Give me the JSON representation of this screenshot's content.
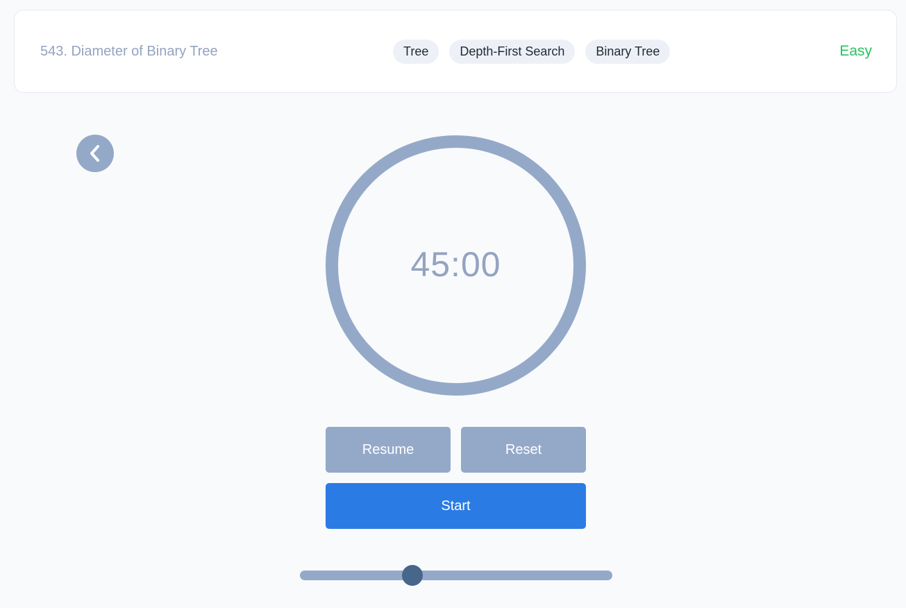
{
  "header": {
    "problem_title": "543. Diameter of Binary Tree",
    "tags": [
      "Tree",
      "Depth-First Search",
      "Binary Tree"
    ],
    "difficulty": "Easy",
    "difficulty_color": "#22c55e"
  },
  "back_button": {
    "icon": "chevron-left-icon"
  },
  "timer": {
    "display": "45:00",
    "ring_color": "#94a9c8"
  },
  "controls": {
    "resume_label": "Resume",
    "reset_label": "Reset",
    "start_label": "Start",
    "start_color": "#2b7be4",
    "secondary_color": "#94a9c8"
  },
  "duration_slider": {
    "fraction": 0.36
  }
}
